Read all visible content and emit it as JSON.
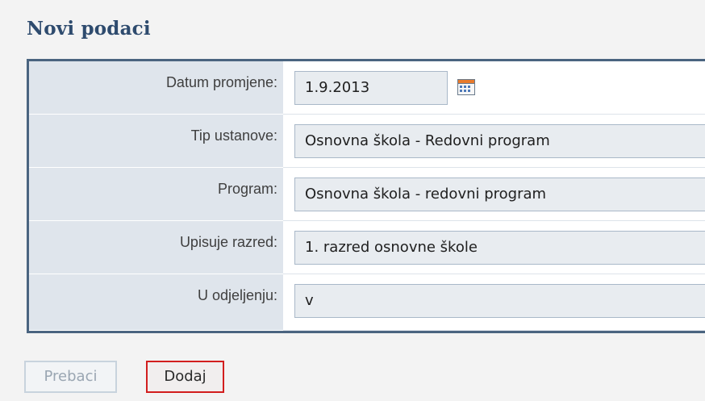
{
  "title": "Novi podaci",
  "form": {
    "rows": [
      {
        "label": "Datum promjene:",
        "value": "1.9.2013"
      },
      {
        "label": "Tip ustanove:",
        "value": "Osnovna škola - Redovni program"
      },
      {
        "label": "Program:",
        "value": "Osnovna škola - redovni program"
      },
      {
        "label": "Upisuje razred:",
        "value": "1. razred osnovne škole"
      },
      {
        "label": "U odjeljenju:",
        "value": "v"
      }
    ],
    "date_picker_icon": "calendar-icon"
  },
  "buttons": {
    "prebaci": "Prebaci",
    "dodaj": "Dodaj"
  },
  "colors": {
    "title": "#2e4b6e",
    "panel_border": "#4a6480",
    "label_bg": "#dfe5ec",
    "dodaj_border": "#d21e1e"
  }
}
